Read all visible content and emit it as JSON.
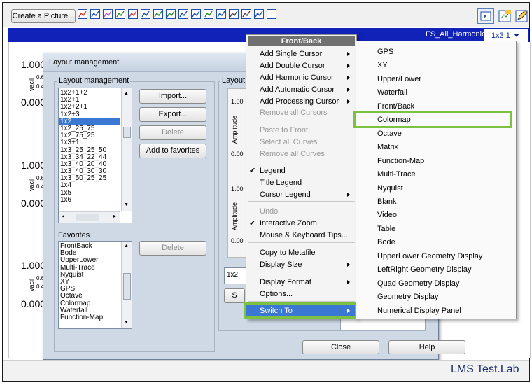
{
  "toolbar": {
    "create_picture_label": "Create a Picture...",
    "icons": [
      "line-chart-icon",
      "stacked-chart-icon",
      "waterfall-icon",
      "multi-trace-icon",
      "polar-icon",
      "grid-icon",
      "image-icon",
      "bar-chart-icon",
      "colormap-icon",
      "function-icon",
      "list-icon",
      "marker-icon",
      "table-icon",
      "table2-icon",
      "cursor-icon",
      "blank-icon"
    ],
    "right_icons": [
      "fit-window-icon",
      "export-icon",
      "edit-icon"
    ]
  },
  "header": {
    "project": "FS_All_Harmonics",
    "layout_tab": "1x3 1"
  },
  "plots": {
    "max_labels": [
      "1.000",
      "1.000",
      "1.000"
    ],
    "zero_labels": [
      "0.000",
      "0.000",
      "0.000"
    ],
    "small_top": [
      "0.6",
      "0.6",
      "0.6"
    ],
    "small_bot": [
      "0.4",
      "0.4",
      "0.4"
    ],
    "ylabel": "vacil"
  },
  "dialog": {
    "title": "Layout management",
    "group_layout_label": "Layout management",
    "layouts": [
      "1x2+1+2",
      "1x2+1",
      "1x2+2+1",
      "1x2+3",
      "1x2",
      "1x2_25_75",
      "1x2_75_25",
      "1x3+1",
      "1x3_25_25_50",
      "1x3_34_22_44",
      "1x3_40_20_40",
      "1x3_40_30_30",
      "1x3_50_25_25",
      "1x4",
      "1x5",
      "1x6"
    ],
    "selected_layout": "1x2",
    "import_label": "Import...",
    "export_label": "Export...",
    "delete_label": "Delete",
    "add_favorites_label": "Add to favorites",
    "favorites_label": "Favorites",
    "favorites": [
      "FrontBack",
      "Bode",
      "UpperLower",
      "Multi-Trace",
      "Nyquist",
      "XY",
      "GPS",
      "Octave",
      "Colormap",
      "Waterfall",
      "Function-Map"
    ],
    "favorites_delete_label": "Delete",
    "preview_group_label": "Layout",
    "preview_y_values": [
      "1.00",
      "0.00",
      "1.00",
      "0.00"
    ],
    "preview_ylabel": "Amplitude",
    "name_value": "1x2",
    "s_label": "S",
    "close_label": "Close",
    "help_label": "Help"
  },
  "context_menu": {
    "title": "Front/Back",
    "items": [
      {
        "label": "Add Single Cursor",
        "arrow": true,
        "disabled": false
      },
      {
        "label": "Add Double Cursor",
        "arrow": true,
        "disabled": false
      },
      {
        "label": "Add Harmonic Cursor",
        "arrow": true,
        "disabled": false
      },
      {
        "label": "Add Automatic Cursor",
        "arrow": true,
        "disabled": false
      },
      {
        "label": "Add Processing Cursor",
        "arrow": true,
        "disabled": false
      },
      {
        "label": "Remove all Cursors",
        "arrow": false,
        "disabled": true
      },
      {
        "label": "Paste to Front",
        "arrow": false,
        "disabled": true
      },
      {
        "label": "Select all Curves",
        "arrow": false,
        "disabled": true
      },
      {
        "label": "Remove all Curves",
        "arrow": false,
        "disabled": true
      },
      {
        "label": "Legend",
        "arrow": false,
        "disabled": false,
        "checked": true
      },
      {
        "label": "Title Legend",
        "arrow": false,
        "disabled": false
      },
      {
        "label": "Cursor Legend",
        "arrow": true,
        "disabled": false
      },
      {
        "label": "Undo",
        "arrow": false,
        "disabled": true
      },
      {
        "label": "Interactive Zoom",
        "arrow": false,
        "disabled": false,
        "checked": true
      },
      {
        "label": "Mouse & Keyboard Tips...",
        "arrow": false,
        "disabled": false
      },
      {
        "label": "Copy to Metafile",
        "arrow": false,
        "disabled": false
      },
      {
        "label": "Display Size",
        "arrow": true,
        "disabled": false
      },
      {
        "label": "Display Format",
        "arrow": true,
        "disabled": false
      },
      {
        "label": "Options...",
        "arrow": false,
        "disabled": false
      },
      {
        "label": "Switch To",
        "arrow": true,
        "disabled": false,
        "active": true
      }
    ]
  },
  "submenu": {
    "items": [
      "GPS",
      "XY",
      "Upper/Lower",
      "Waterfall",
      "Front/Back",
      "Colormap",
      "Octave",
      "Matrix",
      "Function-Map",
      "Multi-Trace",
      "Nyquist",
      "Blank",
      "Video",
      "Table",
      "Bode",
      "UpperLower Geometry Display",
      "LeftRight Geometry Display",
      "Quad Geometry Display",
      "Geometry Display",
      "Numerical Display Panel"
    ],
    "highlighted": "Colormap"
  },
  "statusbar": {
    "brand": "LMS Test.Lab"
  },
  "colors": {
    "header_blue": "#1122b8",
    "highlight_green": "#7bc142",
    "menu_title_bg": "#707070",
    "selection": "#3a78d4"
  }
}
